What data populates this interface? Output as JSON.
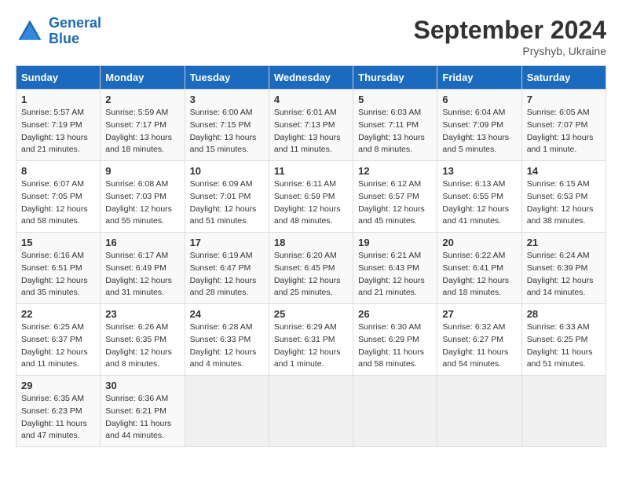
{
  "logo": {
    "line1": "General",
    "line2": "Blue"
  },
  "title": "September 2024",
  "subtitle": "Pryshyb, Ukraine",
  "days_of_week": [
    "Sunday",
    "Monday",
    "Tuesday",
    "Wednesday",
    "Thursday",
    "Friday",
    "Saturday"
  ],
  "weeks": [
    [
      {
        "num": "1",
        "lines": [
          "Sunrise: 5:57 AM",
          "Sunset: 7:19 PM",
          "Daylight: 13 hours",
          "and 21 minutes."
        ]
      },
      {
        "num": "2",
        "lines": [
          "Sunrise: 5:59 AM",
          "Sunset: 7:17 PM",
          "Daylight: 13 hours",
          "and 18 minutes."
        ]
      },
      {
        "num": "3",
        "lines": [
          "Sunrise: 6:00 AM",
          "Sunset: 7:15 PM",
          "Daylight: 13 hours",
          "and 15 minutes."
        ]
      },
      {
        "num": "4",
        "lines": [
          "Sunrise: 6:01 AM",
          "Sunset: 7:13 PM",
          "Daylight: 13 hours",
          "and 11 minutes."
        ]
      },
      {
        "num": "5",
        "lines": [
          "Sunrise: 6:03 AM",
          "Sunset: 7:11 PM",
          "Daylight: 13 hours",
          "and 8 minutes."
        ]
      },
      {
        "num": "6",
        "lines": [
          "Sunrise: 6:04 AM",
          "Sunset: 7:09 PM",
          "Daylight: 13 hours",
          "and 5 minutes."
        ]
      },
      {
        "num": "7",
        "lines": [
          "Sunrise: 6:05 AM",
          "Sunset: 7:07 PM",
          "Daylight: 13 hours",
          "and 1 minute."
        ]
      }
    ],
    [
      {
        "num": "8",
        "lines": [
          "Sunrise: 6:07 AM",
          "Sunset: 7:05 PM",
          "Daylight: 12 hours",
          "and 58 minutes."
        ]
      },
      {
        "num": "9",
        "lines": [
          "Sunrise: 6:08 AM",
          "Sunset: 7:03 PM",
          "Daylight: 12 hours",
          "and 55 minutes."
        ]
      },
      {
        "num": "10",
        "lines": [
          "Sunrise: 6:09 AM",
          "Sunset: 7:01 PM",
          "Daylight: 12 hours",
          "and 51 minutes."
        ]
      },
      {
        "num": "11",
        "lines": [
          "Sunrise: 6:11 AM",
          "Sunset: 6:59 PM",
          "Daylight: 12 hours",
          "and 48 minutes."
        ]
      },
      {
        "num": "12",
        "lines": [
          "Sunrise: 6:12 AM",
          "Sunset: 6:57 PM",
          "Daylight: 12 hours",
          "and 45 minutes."
        ]
      },
      {
        "num": "13",
        "lines": [
          "Sunrise: 6:13 AM",
          "Sunset: 6:55 PM",
          "Daylight: 12 hours",
          "and 41 minutes."
        ]
      },
      {
        "num": "14",
        "lines": [
          "Sunrise: 6:15 AM",
          "Sunset: 6:53 PM",
          "Daylight: 12 hours",
          "and 38 minutes."
        ]
      }
    ],
    [
      {
        "num": "15",
        "lines": [
          "Sunrise: 6:16 AM",
          "Sunset: 6:51 PM",
          "Daylight: 12 hours",
          "and 35 minutes."
        ]
      },
      {
        "num": "16",
        "lines": [
          "Sunrise: 6:17 AM",
          "Sunset: 6:49 PM",
          "Daylight: 12 hours",
          "and 31 minutes."
        ]
      },
      {
        "num": "17",
        "lines": [
          "Sunrise: 6:19 AM",
          "Sunset: 6:47 PM",
          "Daylight: 12 hours",
          "and 28 minutes."
        ]
      },
      {
        "num": "18",
        "lines": [
          "Sunrise: 6:20 AM",
          "Sunset: 6:45 PM",
          "Daylight: 12 hours",
          "and 25 minutes."
        ]
      },
      {
        "num": "19",
        "lines": [
          "Sunrise: 6:21 AM",
          "Sunset: 6:43 PM",
          "Daylight: 12 hours",
          "and 21 minutes."
        ]
      },
      {
        "num": "20",
        "lines": [
          "Sunrise: 6:22 AM",
          "Sunset: 6:41 PM",
          "Daylight: 12 hours",
          "and 18 minutes."
        ]
      },
      {
        "num": "21",
        "lines": [
          "Sunrise: 6:24 AM",
          "Sunset: 6:39 PM",
          "Daylight: 12 hours",
          "and 14 minutes."
        ]
      }
    ],
    [
      {
        "num": "22",
        "lines": [
          "Sunrise: 6:25 AM",
          "Sunset: 6:37 PM",
          "Daylight: 12 hours",
          "and 11 minutes."
        ]
      },
      {
        "num": "23",
        "lines": [
          "Sunrise: 6:26 AM",
          "Sunset: 6:35 PM",
          "Daylight: 12 hours",
          "and 8 minutes."
        ]
      },
      {
        "num": "24",
        "lines": [
          "Sunrise: 6:28 AM",
          "Sunset: 6:33 PM",
          "Daylight: 12 hours",
          "and 4 minutes."
        ]
      },
      {
        "num": "25",
        "lines": [
          "Sunrise: 6:29 AM",
          "Sunset: 6:31 PM",
          "Daylight: 12 hours",
          "and 1 minute."
        ]
      },
      {
        "num": "26",
        "lines": [
          "Sunrise: 6:30 AM",
          "Sunset: 6:29 PM",
          "Daylight: 11 hours",
          "and 58 minutes."
        ]
      },
      {
        "num": "27",
        "lines": [
          "Sunrise: 6:32 AM",
          "Sunset: 6:27 PM",
          "Daylight: 11 hours",
          "and 54 minutes."
        ]
      },
      {
        "num": "28",
        "lines": [
          "Sunrise: 6:33 AM",
          "Sunset: 6:25 PM",
          "Daylight: 11 hours",
          "and 51 minutes."
        ]
      }
    ],
    [
      {
        "num": "29",
        "lines": [
          "Sunrise: 6:35 AM",
          "Sunset: 6:23 PM",
          "Daylight: 11 hours",
          "and 47 minutes."
        ]
      },
      {
        "num": "30",
        "lines": [
          "Sunrise: 6:36 AM",
          "Sunset: 6:21 PM",
          "Daylight: 11 hours",
          "and 44 minutes."
        ]
      },
      {
        "num": "",
        "lines": []
      },
      {
        "num": "",
        "lines": []
      },
      {
        "num": "",
        "lines": []
      },
      {
        "num": "",
        "lines": []
      },
      {
        "num": "",
        "lines": []
      }
    ]
  ]
}
